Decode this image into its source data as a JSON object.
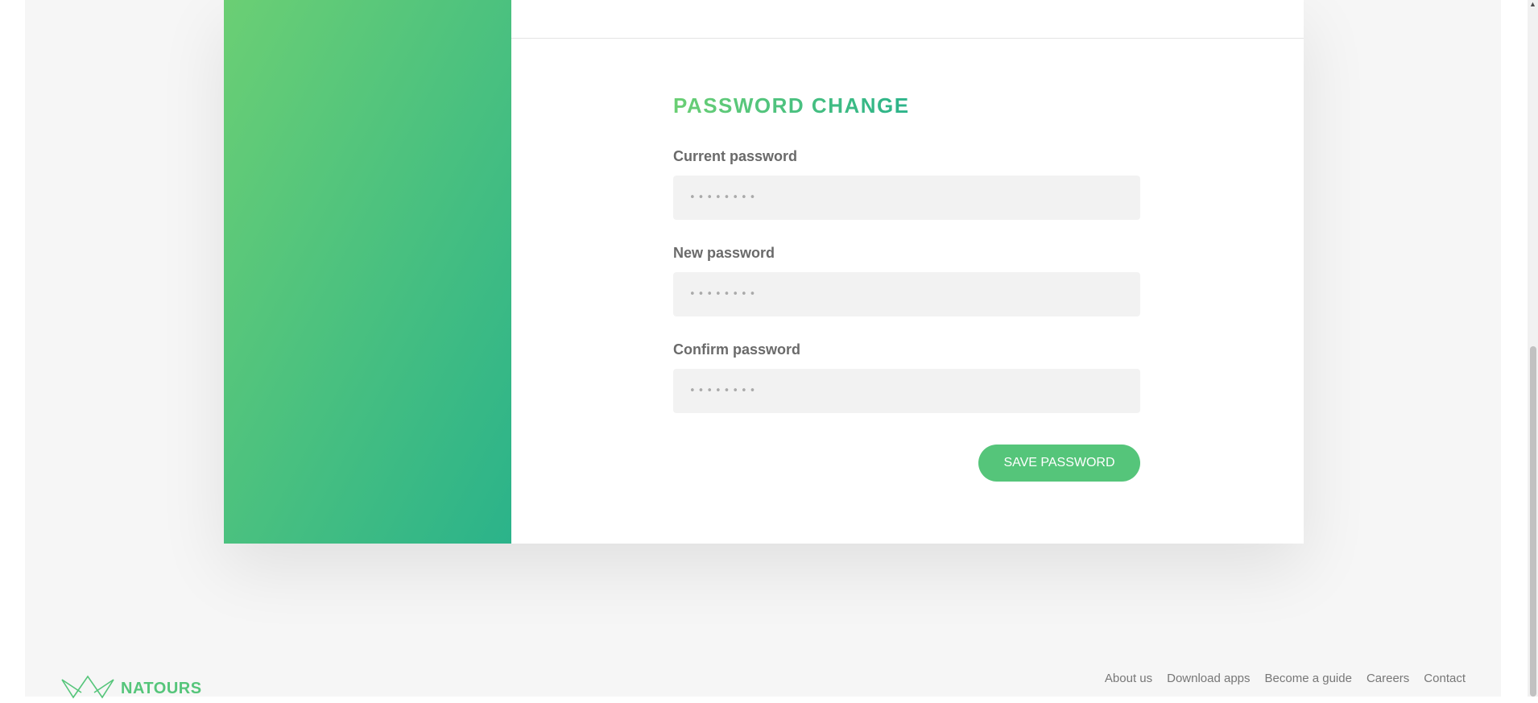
{
  "password_form": {
    "title": "PASSWORD CHANGE",
    "current_label": "Current password",
    "current_value": "••••••••",
    "new_label": "New password",
    "new_value": "••••••••",
    "confirm_label": "Confirm password",
    "confirm_value": "••••••••",
    "save_label": "SAVE PASSWORD"
  },
  "footer": {
    "logo_text": "NATOURS",
    "links": [
      "About us",
      "Download apps",
      "Become a guide",
      "Careers",
      "Contact"
    ]
  },
  "colors": {
    "accent": "#55c57a",
    "gradient_start": "#6bcf74",
    "gradient_end": "#2bb38a",
    "background": "#f6f6f6"
  }
}
